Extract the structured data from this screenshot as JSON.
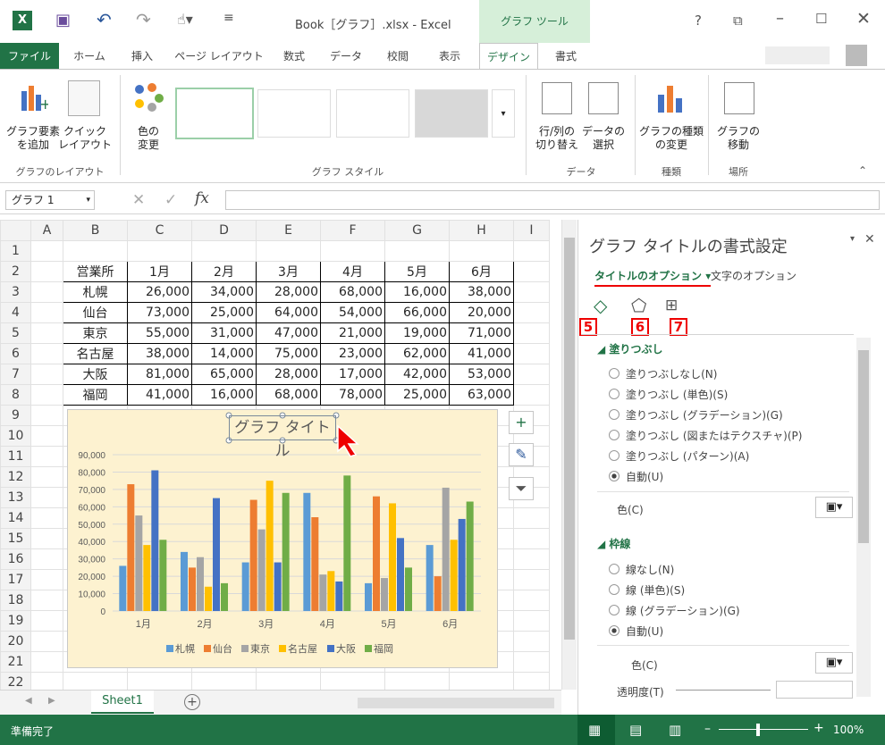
{
  "window": {
    "title": "Book［グラフ］.xlsx - Excel",
    "context_tab": "グラフ ツール"
  },
  "tabs": [
    "ファイル",
    "ホーム",
    "挿入",
    "ページ レイアウト",
    "数式",
    "データ",
    "校閲",
    "表示",
    "デザイン",
    "書式"
  ],
  "ribbon": {
    "add_element": "グラフ要素\nを追加",
    "quick_layout": "クイック\nレイアウト",
    "layout_group": "グラフのレイアウト",
    "change_colors": "色の\n変更",
    "style_group": "グラフ スタイル",
    "switch_rowcol": "行/列の\n切り替え",
    "select_data": "データの\n選択",
    "data_group": "データ",
    "change_type": "グラフの種類\nの変更",
    "type_group": "種類",
    "move_chart": "グラフの\n移動",
    "location_group": "場所"
  },
  "formula": {
    "name_box": "グラフ 1",
    "fx": "fx",
    "value": ""
  },
  "sheet": {
    "col_headers": [
      "",
      "A",
      "B",
      "C",
      "D",
      "E",
      "F",
      "G",
      "H",
      "I"
    ],
    "row_headers": [
      "1",
      "2",
      "3",
      "4",
      "5",
      "6",
      "7",
      "8",
      "9",
      "10",
      "11",
      "12",
      "13",
      "14",
      "15",
      "16",
      "17",
      "18",
      "19",
      "20",
      "21",
      "22"
    ],
    "table_header": [
      "営業所",
      "1月",
      "2月",
      "3月",
      "4月",
      "5月",
      "6月"
    ],
    "rows": [
      [
        "札幌",
        "26,000",
        "34,000",
        "28,000",
        "68,000",
        "16,000",
        "38,000"
      ],
      [
        "仙台",
        "73,000",
        "25,000",
        "64,000",
        "54,000",
        "66,000",
        "20,000"
      ],
      [
        "東京",
        "55,000",
        "31,000",
        "47,000",
        "21,000",
        "19,000",
        "71,000"
      ],
      [
        "名古屋",
        "38,000",
        "14,000",
        "75,000",
        "23,000",
        "62,000",
        "41,000"
      ],
      [
        "大阪",
        "81,000",
        "65,000",
        "28,000",
        "17,000",
        "42,000",
        "53,000"
      ],
      [
        "福岡",
        "41,000",
        "16,000",
        "68,000",
        "78,000",
        "25,000",
        "63,000"
      ]
    ]
  },
  "chart_data": {
    "type": "bar",
    "title": "グラフ タイトル",
    "categories": [
      "1月",
      "2月",
      "3月",
      "4月",
      "5月",
      "6月"
    ],
    "series": [
      {
        "name": "札幌",
        "values": [
          26000,
          34000,
          28000,
          68000,
          16000,
          38000
        ],
        "color": "#5b9bd5"
      },
      {
        "name": "仙台",
        "values": [
          73000,
          25000,
          64000,
          54000,
          66000,
          20000
        ],
        "color": "#ed7d31"
      },
      {
        "name": "東京",
        "values": [
          55000,
          31000,
          47000,
          21000,
          19000,
          71000
        ],
        "color": "#a5a5a5"
      },
      {
        "name": "名古屋",
        "values": [
          38000,
          14000,
          75000,
          23000,
          62000,
          41000
        ],
        "color": "#ffc000"
      },
      {
        "name": "大阪",
        "values": [
          81000,
          65000,
          28000,
          17000,
          42000,
          53000
        ],
        "color": "#4472c4"
      },
      {
        "name": "福岡",
        "values": [
          41000,
          16000,
          68000,
          78000,
          25000,
          63000
        ],
        "color": "#70ad47"
      }
    ],
    "yticks": [
      "0",
      "10,000",
      "20,000",
      "30,000",
      "40,000",
      "50,000",
      "60,000",
      "70,000",
      "80,000",
      "90,000"
    ],
    "ylim": [
      0,
      90000
    ],
    "legend": "bottom",
    "grid": true
  },
  "panel": {
    "title": "グラフ タイトルの書式設定",
    "tab_title_options": "タイトルのオプション",
    "tab_text_options": "文字のオプション",
    "markers": [
      "5",
      "6",
      "7"
    ],
    "fill_section": "塗りつぶし",
    "fill_options": [
      "塗りつぶしなし(N)",
      "塗りつぶし (単色)(S)",
      "塗りつぶし (グラデーション)(G)",
      "塗りつぶし (図またはテクスチャ)(P)",
      "塗りつぶし (パターン)(A)",
      "自動(U)"
    ],
    "fill_color_label": "色(C)",
    "line_section": "枠線",
    "line_options": [
      "線なし(N)",
      "線 (単色)(S)",
      "線 (グラデーション)(G)",
      "自動(U)"
    ],
    "line_color_label": "色(C)",
    "transparency_label": "透明度(T)"
  },
  "sheet_tab": "Sheet1",
  "status": {
    "ready": "準備完了",
    "zoom": "100%"
  },
  "colors": {
    "excel_green": "#217346"
  }
}
